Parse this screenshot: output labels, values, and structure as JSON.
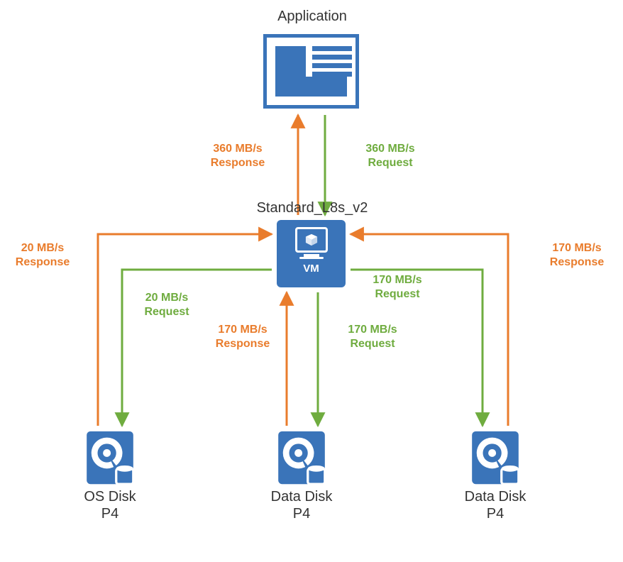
{
  "title": "Application",
  "vm": {
    "name": "Standard_L8s_v2",
    "caption": "VM"
  },
  "disks": {
    "os": {
      "label": "OS Disk",
      "tier": "P4"
    },
    "data1": {
      "label": "Data Disk",
      "tier": "P4"
    },
    "data2": {
      "label": "Data Disk",
      "tier": "P4"
    }
  },
  "flows": {
    "app_response": {
      "rate": "360 MB/s",
      "kind": "Response"
    },
    "app_request": {
      "rate": "360 MB/s",
      "kind": "Request"
    },
    "os_response": {
      "rate": "20 MB/s",
      "kind": "Response"
    },
    "os_request": {
      "rate": "20 MB/s",
      "kind": "Request"
    },
    "d1_response": {
      "rate": "170 MB/s",
      "kind": "Response"
    },
    "d1_request": {
      "rate": "170 MB/s",
      "kind": "Request"
    },
    "d2_response": {
      "rate": "170 MB/s",
      "kind": "Response"
    },
    "d2_request": {
      "rate": "170 MB/s",
      "kind": "Request"
    }
  },
  "colors": {
    "blue": "#3A74B9",
    "orange": "#E97C2C",
    "green": "#6FAC3F"
  }
}
